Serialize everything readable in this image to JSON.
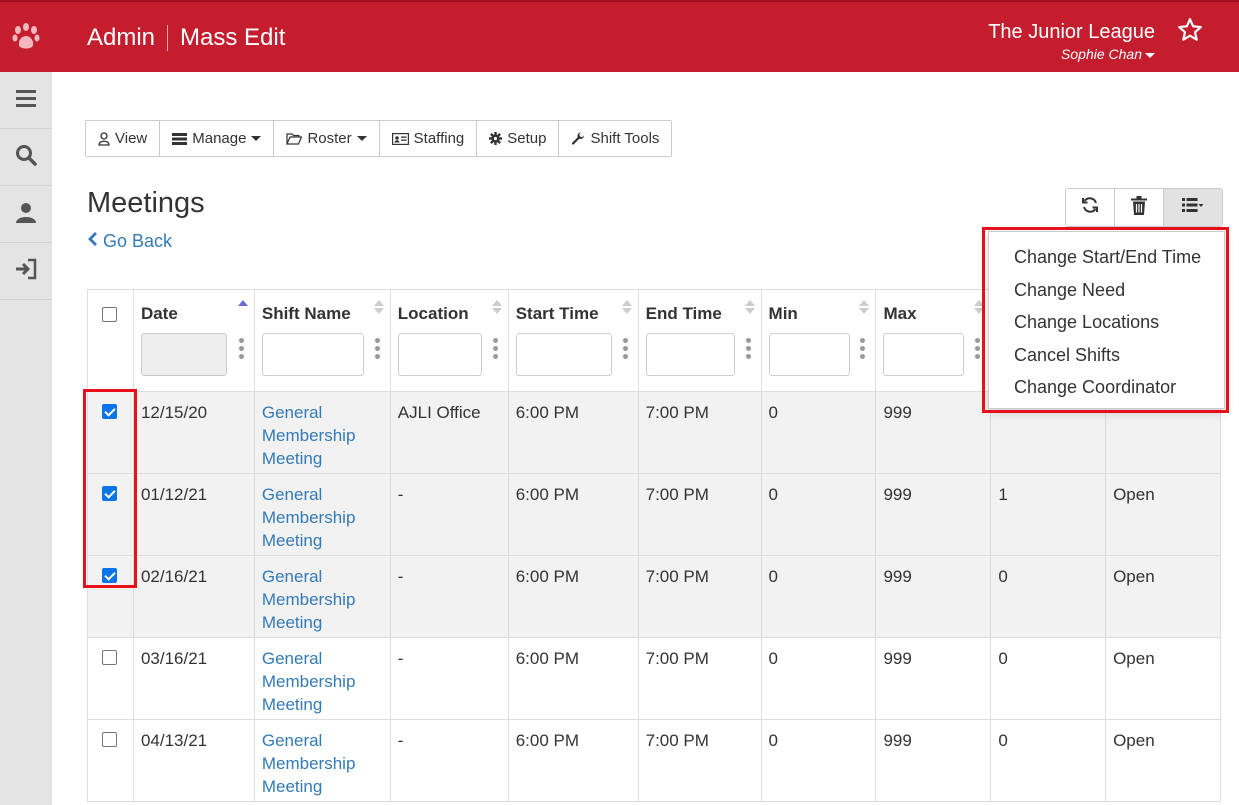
{
  "header": {
    "section": "Admin",
    "page": "Mass Edit",
    "org_name": "The Junior League",
    "user_name": "Sophie Chan"
  },
  "sidebar": {
    "items": [
      {
        "icon": "menu-icon"
      },
      {
        "icon": "search-icon"
      },
      {
        "icon": "user-icon"
      },
      {
        "icon": "sign-in-icon"
      }
    ]
  },
  "toolbar": {
    "view": "View",
    "manage": "Manage",
    "roster": "Roster",
    "staffing": "Staffing",
    "setup": "Setup",
    "shift_tools": "Shift Tools"
  },
  "page": {
    "title": "Meetings",
    "go_back": "Go Back"
  },
  "menu": {
    "items": [
      "Change Start/End Time",
      "Change Need",
      "Change Locations",
      "Cancel Shifts",
      "Change Coordinator"
    ]
  },
  "table": {
    "columns": [
      "Date",
      "Shift Name",
      "Location",
      "Start Time",
      "End Time",
      "Min",
      "Max"
    ],
    "rows": [
      {
        "checked": true,
        "date": "12/15/20",
        "shift": "General Membership Meeting",
        "location": "AJLI Office",
        "start": "6:00 PM",
        "end": "7:00 PM",
        "min": "0",
        "max": "999",
        "filled": "",
        "status": ""
      },
      {
        "checked": true,
        "date": "01/12/21",
        "shift": "General Membership Meeting",
        "location": "-",
        "start": "6:00 PM",
        "end": "7:00 PM",
        "min": "0",
        "max": "999",
        "filled": "1",
        "status": "Open"
      },
      {
        "checked": true,
        "date": "02/16/21",
        "shift": "General Membership Meeting",
        "location": "-",
        "start": "6:00 PM",
        "end": "7:00 PM",
        "min": "0",
        "max": "999",
        "filled": "0",
        "status": "Open"
      },
      {
        "checked": false,
        "date": "03/16/21",
        "shift": "General Membership Meeting",
        "location": "-",
        "start": "6:00 PM",
        "end": "7:00 PM",
        "min": "0",
        "max": "999",
        "filled": "0",
        "status": "Open"
      },
      {
        "checked": false,
        "date": "04/13/21",
        "shift": "General Membership Meeting",
        "location": "-",
        "start": "6:00 PM",
        "end": "7:00 PM",
        "min": "0",
        "max": "999",
        "filled": "0",
        "status": "Open"
      }
    ]
  },
  "colors": {
    "brand": "#c41e2e",
    "link": "#337ab7",
    "highlight": "#e8101a",
    "checkbox": "#0a75e8"
  }
}
